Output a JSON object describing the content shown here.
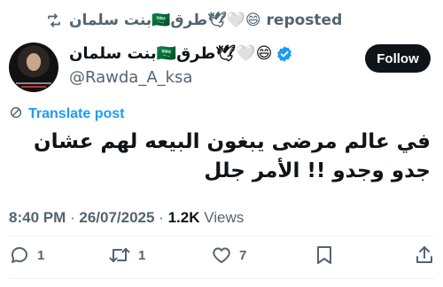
{
  "repost": {
    "label": "بنت سلمان🇸🇦طرق🕊🤍😄 reposted"
  },
  "author": {
    "display_name": "بنت سلمان🇸🇦طرق🕊🤍😄",
    "handle": "@Rawda_A_ksa",
    "verified": true
  },
  "follow_button": {
    "label": "Follow"
  },
  "translate": {
    "label": "Translate post"
  },
  "tweet": {
    "text": "في عالم مرضى يبغون البيعه لهم عشان جدو وجدو !! الأمر جلل"
  },
  "meta": {
    "time": "8:40 PM",
    "separator1": " · ",
    "date": "26/07/2025",
    "separator2": " · ",
    "views_count": "1.2K",
    "views_label": " Views"
  },
  "actions": {
    "reply_count": "1",
    "repost_count": "1",
    "like_count": "7"
  },
  "colors": {
    "accent": "#1d9bf0",
    "text_primary": "#0f1419",
    "text_secondary": "#536471",
    "divider": "#eff3f4",
    "follow_bg": "#0f1419"
  },
  "icons": {
    "repost": "repost-icon",
    "verified": "verified-badge-icon",
    "translate": "translate-icon",
    "reply": "reply-icon",
    "retweet": "retweet-icon",
    "like": "heart-icon",
    "bookmark": "bookmark-icon",
    "share": "share-icon"
  }
}
